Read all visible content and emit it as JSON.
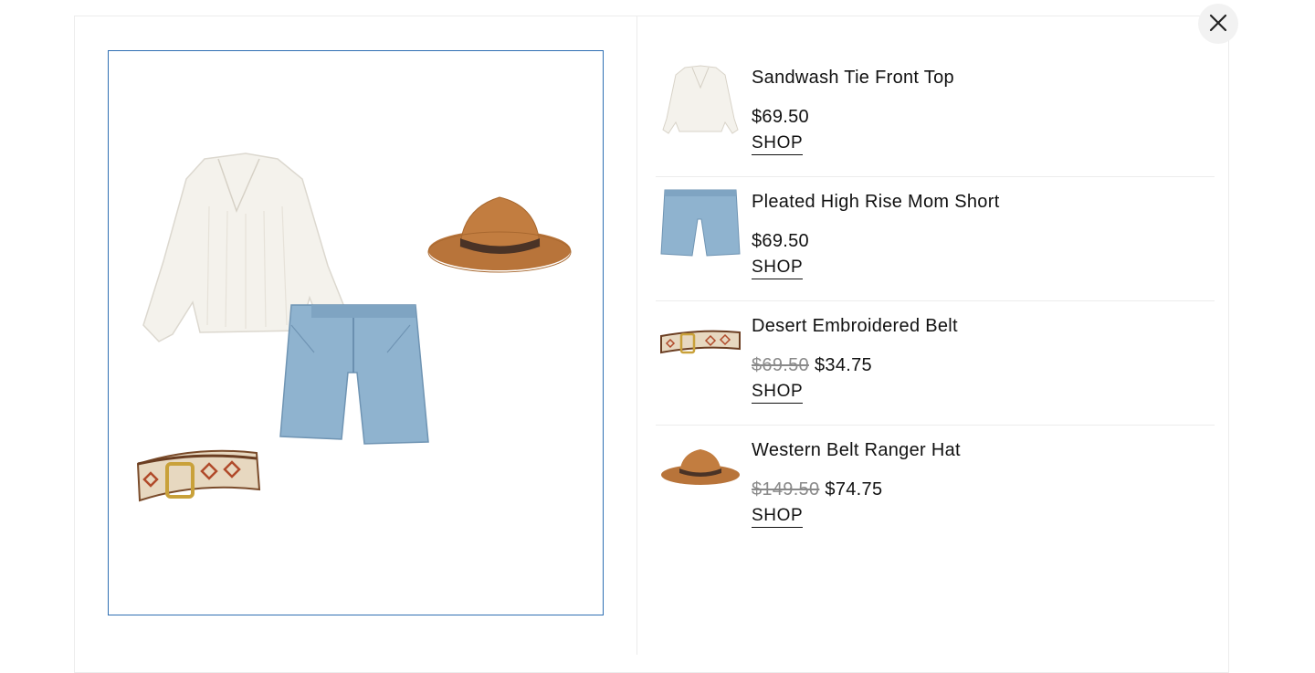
{
  "colors": {
    "frame_border": "#2f6fb3",
    "close_bg": "#f2f2f2",
    "text": "#111111",
    "old_price": "#8a8a8a"
  },
  "close_button": {
    "icon": "close-icon"
  },
  "outfit": {
    "items": [
      "white-blouse",
      "denim-shorts",
      "brown-hat",
      "embroidered-belt"
    ]
  },
  "products": [
    {
      "name": "Sandwash Tie Front Top",
      "price": "$69.50",
      "original_price": "",
      "shop_label": "SHOP",
      "thumb": "white-blouse"
    },
    {
      "name": "Pleated High Rise Mom Short",
      "price": "$69.50",
      "original_price": "",
      "shop_label": "SHOP",
      "thumb": "denim-shorts"
    },
    {
      "name": "Desert Embroidered Belt",
      "price": "$34.75",
      "original_price": "$69.50",
      "shop_label": "SHOP",
      "thumb": "embroidered-belt"
    },
    {
      "name": "Western Belt Ranger Hat",
      "price": "$74.75",
      "original_price": "$149.50",
      "shop_label": "SHOP",
      "thumb": "brown-hat"
    }
  ]
}
